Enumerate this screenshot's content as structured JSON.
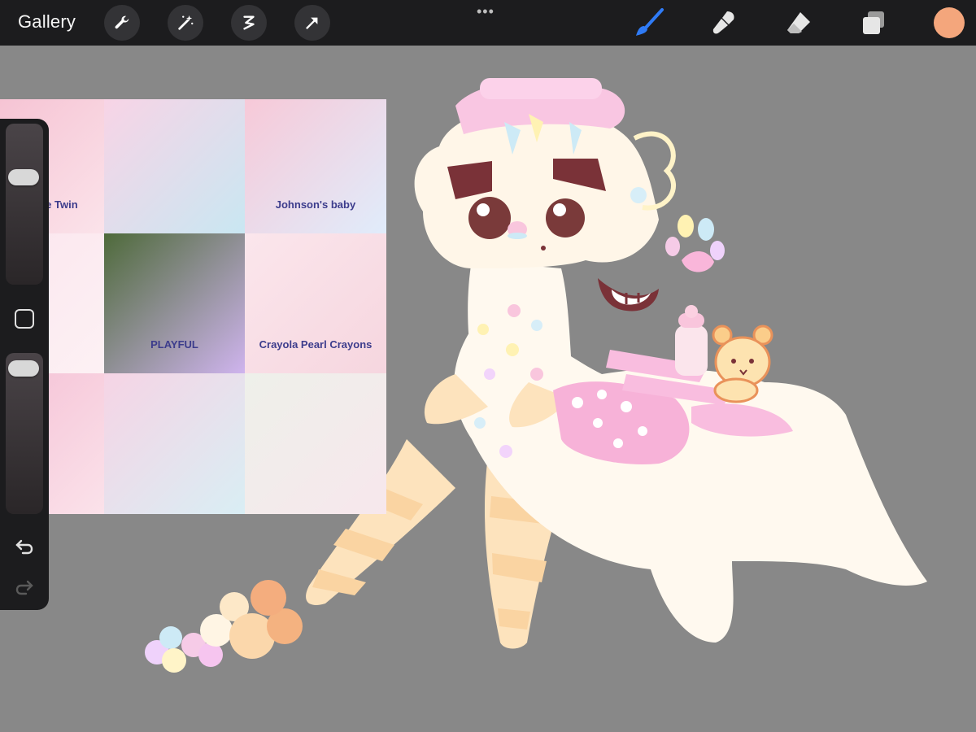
{
  "topbar": {
    "gallery_label": "Gallery",
    "left_tools": [
      "wrench-icon",
      "magic-wand-icon",
      "selection-icon",
      "transform-arrow-icon"
    ],
    "more_label": "•••",
    "right_tools": [
      "brush-icon",
      "smudge-icon",
      "eraser-icon",
      "layers-icon"
    ],
    "current_color": "#f4a67c"
  },
  "reference_image": {
    "cells": [
      {
        "label": "Little Twin",
        "colors": [
          "#f6c4d4",
          "#fbe3ea"
        ]
      },
      {
        "label": "",
        "colors": [
          "#f8d4e6",
          "#c9e7f2"
        ]
      },
      {
        "label": "Johnson's baby",
        "colors": [
          "#f7c9d8",
          "#e0ecfb"
        ]
      },
      {
        "label": "",
        "colors": [
          "#fbe6ee",
          "#fdf1f4"
        ]
      },
      {
        "label": "PLAYFUL",
        "colors": [
          "#4e6a3a",
          "#cfb4ee"
        ]
      },
      {
        "label": "Crayola Pearl Crayons",
        "colors": [
          "#fbe6ec",
          "#f6d6df"
        ]
      },
      {
        "label": "",
        "colors": [
          "#f5c2d6",
          "#fbe2ea"
        ]
      },
      {
        "label": "",
        "colors": [
          "#f6d4e5",
          "#d9eef4"
        ]
      },
      {
        "label": "",
        "colors": [
          "#eef0ea",
          "#f7e7ec"
        ]
      }
    ]
  },
  "sidebar": {
    "size_slider_level": 0.28,
    "opacity_slider_level": 0.03,
    "modify_button": "square-icon",
    "undo": "undo-icon",
    "redo": "redo-icon"
  },
  "palette": {
    "cream": "#fff9ef",
    "peach": "#fde1b8",
    "pink": "#f9b6da",
    "blue": "#bfe5f6",
    "lilac": "#efd2fb",
    "brow": "#7a3238",
    "orange": "#f0a070"
  }
}
